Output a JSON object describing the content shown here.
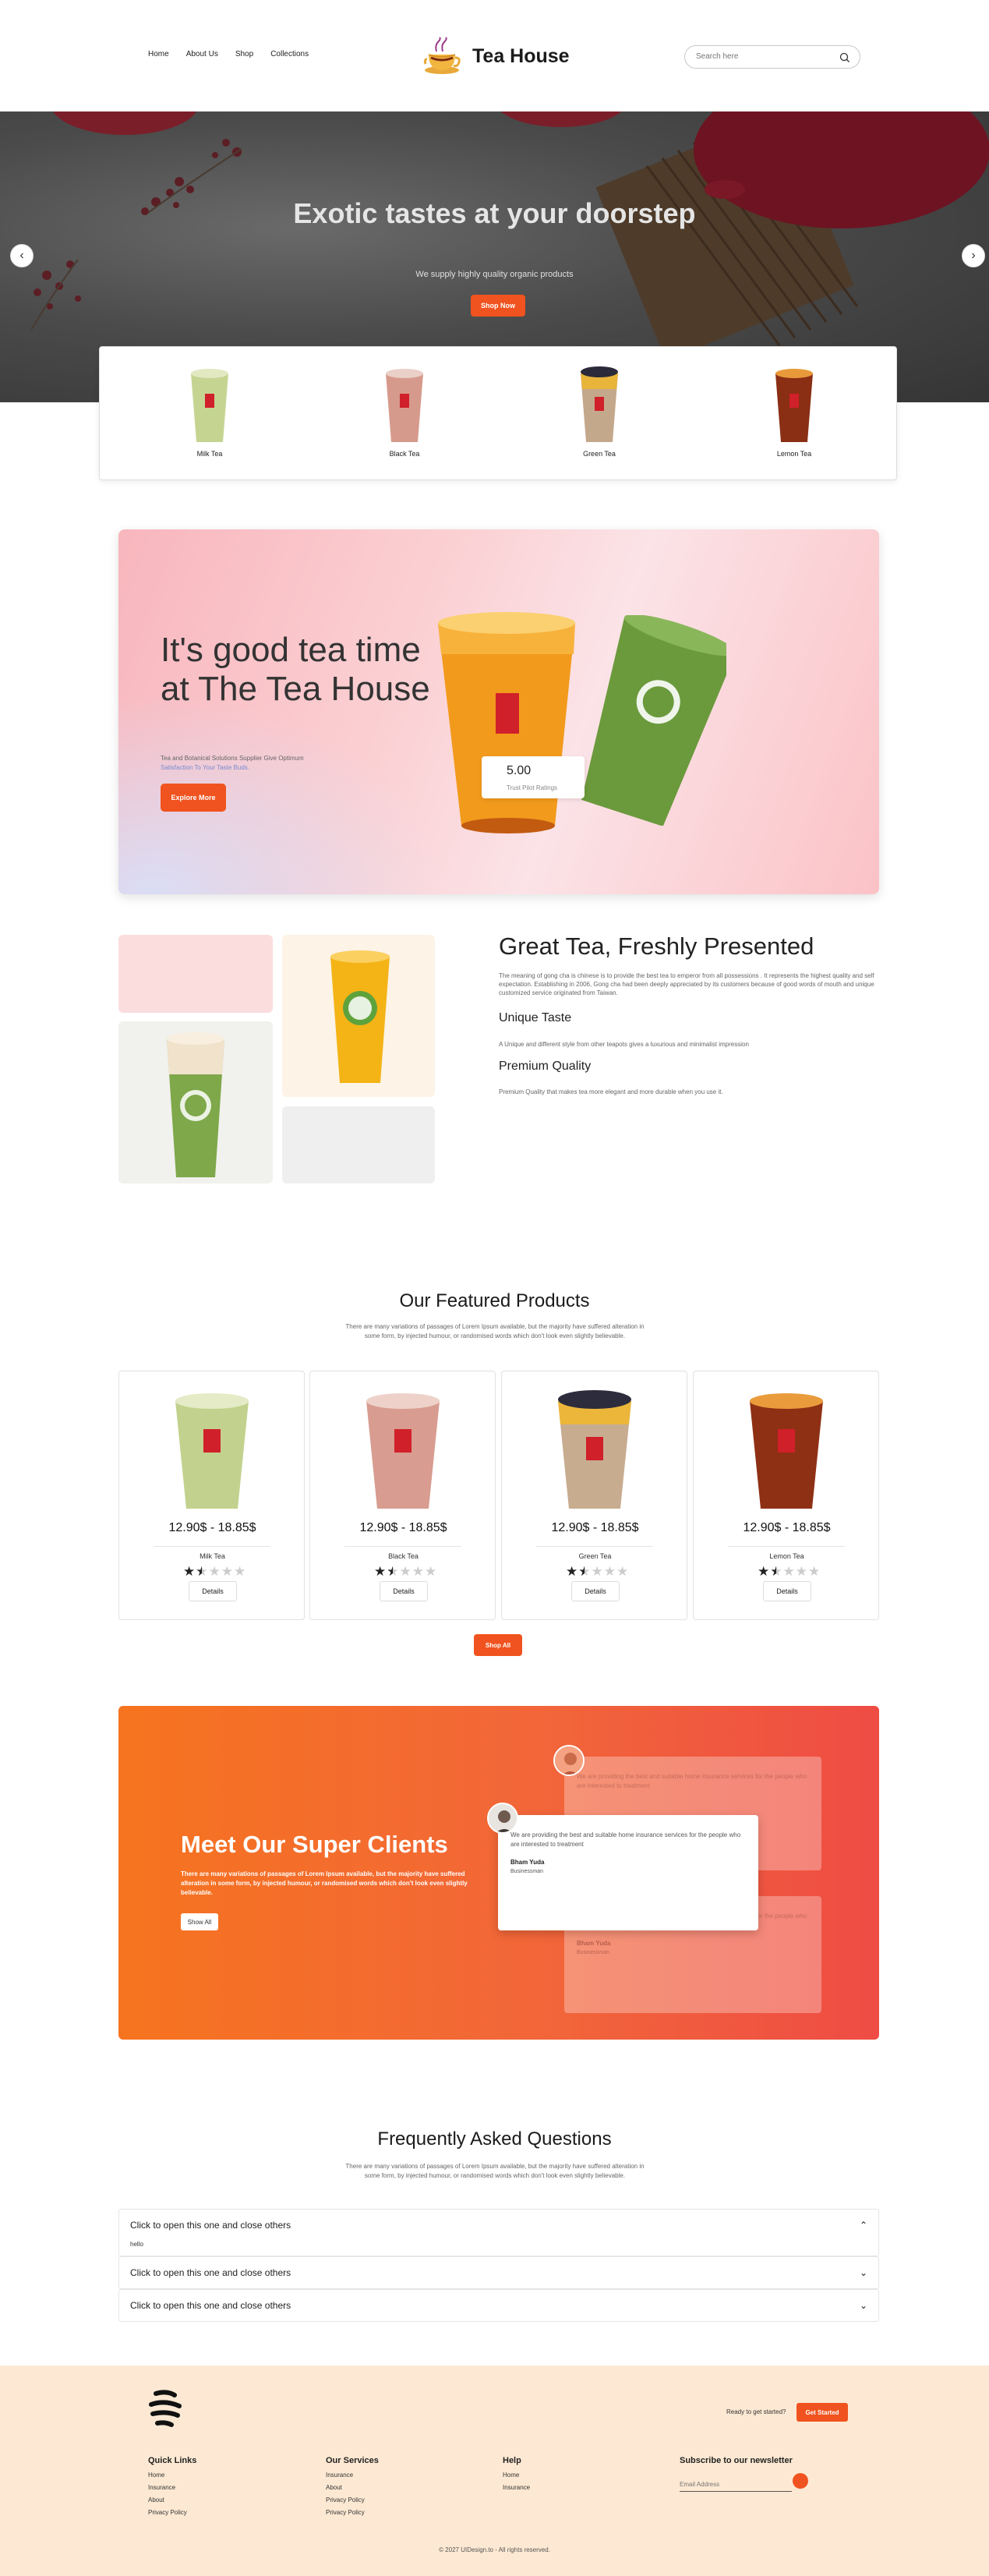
{
  "nav": {
    "links": [
      "Home",
      "About Us",
      "Shop",
      "Collections"
    ],
    "brand": "Tea House",
    "search_placeholder": "Search here"
  },
  "hero": {
    "title": "Exotic tastes at your doorstep",
    "subtitle": "We supply highly quality organic products",
    "button": "Shop Now"
  },
  "categories": [
    "Milk Tea",
    "Black Tea",
    "Green Tea",
    "Lemon Tea"
  ],
  "promo": {
    "title": "It's good tea time at The Tea House",
    "desc_line1": "Tea and Botanical Solutions Supplier Give Optimum",
    "desc_line2": "Satisfaction To Your Taste Buds.",
    "button": "Explore More",
    "rating_value": "5.00",
    "rating_label": "Trust Pilot Ratings"
  },
  "great_tea": {
    "title": "Great Tea, Freshly Presented",
    "intro": "The meaning of gong cha is chinese is to provide the best tea to emperor from all possessions . It represents the highest quality and self expectation. Establishing in 2006, Gong cha had been deeply appreciated by its customers because of good words of mouth and unique customized service originated from Taiwan.",
    "h1": "Unique Taste",
    "p1": "A Unique and different style from other teapots gives a luxurious and minimalist impression",
    "h2": "Premium Quality",
    "p2": "Premium Quality that makes tea more elegant and more durable when you use it."
  },
  "featured": {
    "title": "Our Featured Products",
    "subtitle": "There are many variations of passages of Lorem Ipsum available, but the majority have suffered alteration in some form, by injected humour, or randomised words which don't look even slightly believable.",
    "products": [
      {
        "price": "12.90$ - 18.85$",
        "name": "Milk Tea",
        "rating": 1.5,
        "details": "Details"
      },
      {
        "price": "12.90$ - 18.85$",
        "name": "Black Tea",
        "rating": 1.5,
        "details": "Details"
      },
      {
        "price": "12.90$ - 18.85$",
        "name": "Green Tea",
        "rating": 1.5,
        "details": "Details"
      },
      {
        "price": "12.90$ - 18.85$",
        "name": "Lemon Tea",
        "rating": 1.5,
        "details": "Details"
      }
    ],
    "shop_all": "Shop All"
  },
  "clients": {
    "title": "Meet Our Super Clients",
    "desc": "There are many variations of passages of Lorem Ipsum available, but the majority have suffered alteration in some form, by injected humour, or randomised words which don't look even slightly believable.",
    "button": "Show All",
    "testimonial_text": "We are providing the best and suitable home insurance services for the people who are interested to treatment",
    "name": "Bham Yuda",
    "role": "Businessman"
  },
  "faq": {
    "title": "Frequently Asked Questions",
    "subtitle": "There are many variations of passages of Lorem Ipsum available, but the majority have suffered alteration in some form, by injected humour, or randomised words which don't look even slightly believable.",
    "items": [
      {
        "q": "Click to open this one and close others",
        "a": "hello"
      },
      {
        "q": "Click to open this one and close others"
      },
      {
        "q": "Click to open this one and close others"
      }
    ]
  },
  "footer": {
    "cta_text": "Ready to get started?",
    "cta_button": "Get Started",
    "col1_title": "Quick Links",
    "col1": [
      "Home",
      "Insurance",
      "About",
      "Privacy Policy"
    ],
    "col2_title": "Our Services",
    "col2": [
      "Insurance",
      "About",
      "Privacy Policy",
      "Privacy Policy"
    ],
    "col3_title": "Help",
    "col3": [
      "Home",
      "Insurance"
    ],
    "newsletter_title": "Subscribe to our newsletter",
    "email_placeholder": "Email Address",
    "copyright": "© 2027 UIDesign.to - All rights reserved."
  },
  "colors": {
    "accent": "#f0531f",
    "promo_bg": "#fbd0d3",
    "clients_bg": "#f26639",
    "footer_bg": "#fde9d3"
  }
}
